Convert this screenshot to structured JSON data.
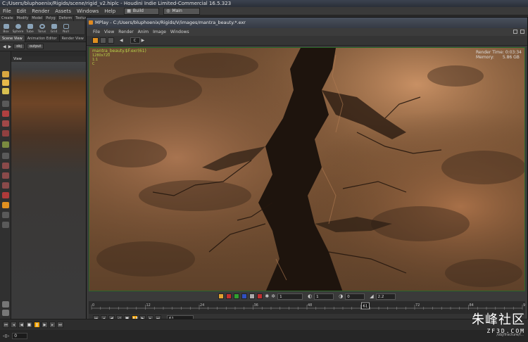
{
  "houdini": {
    "window_title": "C:/Users/bluphoenix/Rigids/scene/rigid_v2.hiplc - Houdini Indie Limited-Commercial 16.5.323",
    "menus": [
      "File",
      "Edit",
      "Render",
      "Assets",
      "Windows",
      "Help"
    ],
    "desktop": "Build",
    "main": "Main",
    "shelf_tabs": [
      "Create",
      "Modify",
      "Model",
      "Polyg",
      "Deform",
      "Texture"
    ],
    "shelf_tools": [
      "Box",
      "Sphere",
      "Tube",
      "Torus",
      "Grid",
      "Null"
    ],
    "pane_tabs": [
      "Scene View",
      "Animation Editor",
      "Render View"
    ],
    "path": [
      "obj",
      "output"
    ],
    "view_label": "View",
    "frame": "0",
    "status_path": "/obj/fracture/f..."
  },
  "mplay": {
    "title": "MPlay - C:/Users/bluphoenix/Rigids/V/images/mantra_beauty.*.exr",
    "menus": [
      "File",
      "View",
      "Render",
      "Anim",
      "Image",
      "Windows"
    ],
    "zoom": "C",
    "overlay": {
      "filename": "mantra_beauty.$F.exr(61)",
      "resolution": "1280x720",
      "aspect": "1:1",
      "channel": "C"
    },
    "render_time_label": "Render Time:",
    "render_time": "0:03:34",
    "memory_label": "Memory:",
    "memory": "5.86 GB",
    "controls": {
      "field_a": "1",
      "field_b": "1",
      "field_c": "0",
      "gamma": "2.2"
    },
    "timeline": {
      "ticks": [
        "0",
        "12",
        "24",
        "36",
        "48",
        "61",
        "72",
        "84",
        "96"
      ],
      "current": "61"
    },
    "frame": "61"
  },
  "watermark": {
    "cn": "朱峰社区",
    "url": "ZF3D.COM"
  },
  "colors": {
    "accent": "#f2a100",
    "sand": "#7a5434",
    "overlay_text": "#b8d24a"
  }
}
